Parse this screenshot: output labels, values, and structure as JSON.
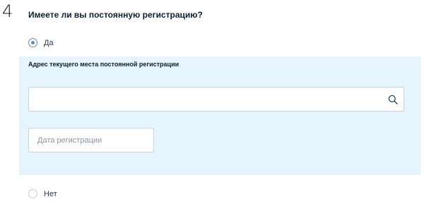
{
  "step": {
    "number": "4"
  },
  "question": {
    "text": "Имеете ли вы постоянную регистрацию?"
  },
  "options": [
    {
      "label": "Да",
      "checked": true
    },
    {
      "label": "Нет",
      "checked": false
    }
  ],
  "address_panel": {
    "label": "Адрес текущего места постоянной регистрации",
    "search": {
      "value": "",
      "placeholder": "",
      "icon": "search-icon"
    },
    "date": {
      "placeholder": "Дата регистрации",
      "value": ""
    }
  },
  "colors": {
    "panel_background": "#e6f4fd",
    "accent": "#5b8cc5",
    "text": "#0b1f33",
    "border": "#c9d3dc"
  }
}
